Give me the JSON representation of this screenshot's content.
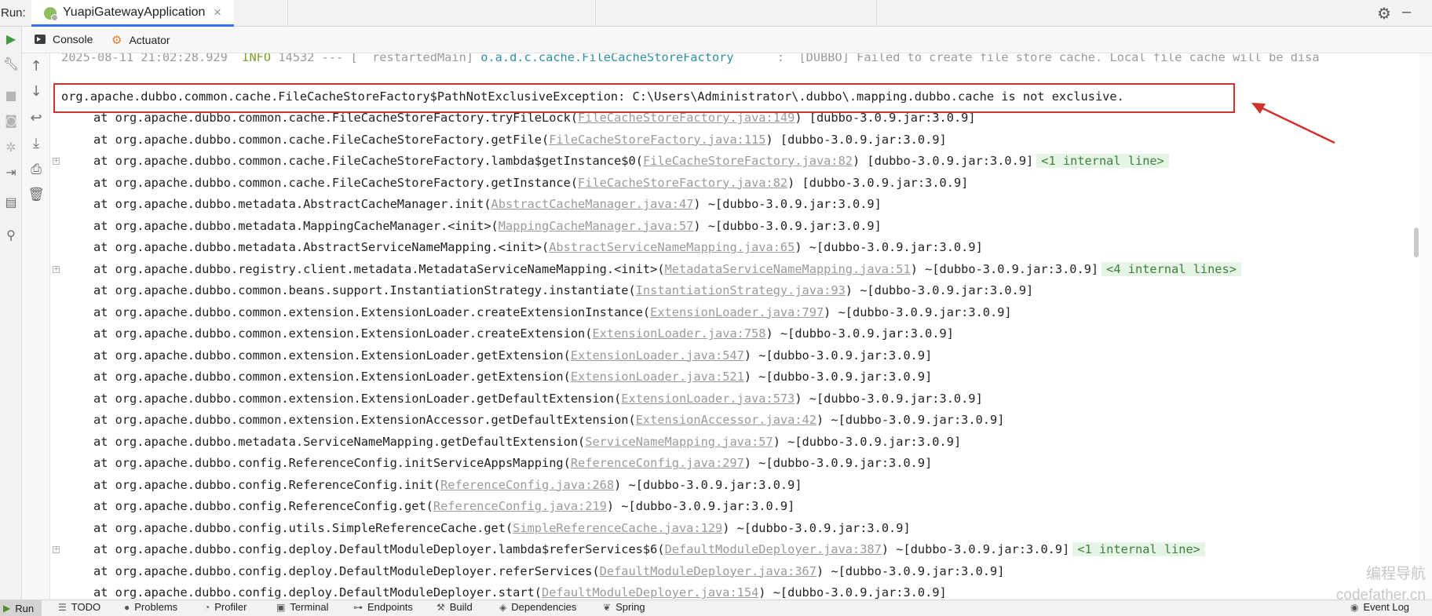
{
  "run_bar": {
    "label": "Run:",
    "tab_title": "YuapiGatewayApplication",
    "close_glyph": "×",
    "settings_icon": "gear-icon",
    "minimize_icon": "minimize-icon"
  },
  "sub_toolbar": {
    "tabs": [
      {
        "label": "Console",
        "icon": "console-icon"
      },
      {
        "label": "Actuator",
        "icon": "actuator-icon"
      }
    ]
  },
  "left_strip_icons": [
    "rerun-icon",
    "wrench-icon",
    "stop-icon",
    "camera-icon",
    "gear-icon",
    "login-icon",
    "layout-icon",
    "pin-icon"
  ],
  "console_toolbar_icons": [
    "up-arrow-icon",
    "down-arrow-icon",
    "soft-wrap-icon",
    "scroll-to-end-icon",
    "print-icon",
    "trash-icon"
  ],
  "console": {
    "top_log": {
      "date": "2025-08-11 21:02:28.929",
      "level": "INFO",
      "pid": "14532",
      "sep": "---",
      "thread": "[  restartedMain]",
      "logger": "o.a.d.c.cache.FileCacheStoreFactory",
      "message": ":  [DUBBO] Failed to create file store cache. Local file cache will be disa"
    },
    "exception": "org.apache.dubbo.common.cache.FileCacheStoreFactory$PathNotExclusiveException: C:\\Users\\Administrator\\.dubbo\\.mapping.dubbo.cache is not exclusive.",
    "frames": [
      {
        "method": "at org.apache.dubbo.common.cache.FileCacheStoreFactory.tryFileLock(",
        "link": "FileCacheStoreFactory.java:149",
        "tail": ") [dubbo-3.0.9.jar:3.0.9]",
        "badge": ""
      },
      {
        "method": "at org.apache.dubbo.common.cache.FileCacheStoreFactory.getFile(",
        "link": "FileCacheStoreFactory.java:115",
        "tail": ") [dubbo-3.0.9.jar:3.0.9]",
        "badge": ""
      },
      {
        "method": "at org.apache.dubbo.common.cache.FileCacheStoreFactory.lambda$getInstance$0(",
        "link": "FileCacheStoreFactory.java:82",
        "tail": ") [dubbo-3.0.9.jar:3.0.9]",
        "badge": "<1 internal line>"
      },
      {
        "method": "at org.apache.dubbo.common.cache.FileCacheStoreFactory.getInstance(",
        "link": "FileCacheStoreFactory.java:82",
        "tail": ") [dubbo-3.0.9.jar:3.0.9]",
        "badge": ""
      },
      {
        "method": "at org.apache.dubbo.metadata.AbstractCacheManager.init(",
        "link": "AbstractCacheManager.java:47",
        "tail": ") ~[dubbo-3.0.9.jar:3.0.9]",
        "badge": ""
      },
      {
        "method": "at org.apache.dubbo.metadata.MappingCacheManager.<init>(",
        "link": "MappingCacheManager.java:57",
        "tail": ") ~[dubbo-3.0.9.jar:3.0.9]",
        "badge": ""
      },
      {
        "method": "at org.apache.dubbo.metadata.AbstractServiceNameMapping.<init>(",
        "link": "AbstractServiceNameMapping.java:65",
        "tail": ") ~[dubbo-3.0.9.jar:3.0.9]",
        "badge": ""
      },
      {
        "method": "at org.apache.dubbo.registry.client.metadata.MetadataServiceNameMapping.<init>(",
        "link": "MetadataServiceNameMapping.java:51",
        "tail": ") ~[dubbo-3.0.9.jar:3.0.9]",
        "badge": "<4 internal lines>"
      },
      {
        "method": "at org.apache.dubbo.common.beans.support.InstantiationStrategy.instantiate(",
        "link": "InstantiationStrategy.java:93",
        "tail": ") ~[dubbo-3.0.9.jar:3.0.9]",
        "badge": ""
      },
      {
        "method": "at org.apache.dubbo.common.extension.ExtensionLoader.createExtensionInstance(",
        "link": "ExtensionLoader.java:797",
        "tail": ") ~[dubbo-3.0.9.jar:3.0.9]",
        "badge": ""
      },
      {
        "method": "at org.apache.dubbo.common.extension.ExtensionLoader.createExtension(",
        "link": "ExtensionLoader.java:758",
        "tail": ") ~[dubbo-3.0.9.jar:3.0.9]",
        "badge": ""
      },
      {
        "method": "at org.apache.dubbo.common.extension.ExtensionLoader.getExtension(",
        "link": "ExtensionLoader.java:547",
        "tail": ") ~[dubbo-3.0.9.jar:3.0.9]",
        "badge": ""
      },
      {
        "method": "at org.apache.dubbo.common.extension.ExtensionLoader.getExtension(",
        "link": "ExtensionLoader.java:521",
        "tail": ") ~[dubbo-3.0.9.jar:3.0.9]",
        "badge": ""
      },
      {
        "method": "at org.apache.dubbo.common.extension.ExtensionLoader.getDefaultExtension(",
        "link": "ExtensionLoader.java:573",
        "tail": ") ~[dubbo-3.0.9.jar:3.0.9]",
        "badge": ""
      },
      {
        "method": "at org.apache.dubbo.common.extension.ExtensionAccessor.getDefaultExtension(",
        "link": "ExtensionAccessor.java:42",
        "tail": ") ~[dubbo-3.0.9.jar:3.0.9]",
        "badge": ""
      },
      {
        "method": "at org.apache.dubbo.metadata.ServiceNameMapping.getDefaultExtension(",
        "link": "ServiceNameMapping.java:57",
        "tail": ") ~[dubbo-3.0.9.jar:3.0.9]",
        "badge": ""
      },
      {
        "method": "at org.apache.dubbo.config.ReferenceConfig.initServiceAppsMapping(",
        "link": "ReferenceConfig.java:297",
        "tail": ") ~[dubbo-3.0.9.jar:3.0.9]",
        "badge": ""
      },
      {
        "method": "at org.apache.dubbo.config.ReferenceConfig.init(",
        "link": "ReferenceConfig.java:268",
        "tail": ") ~[dubbo-3.0.9.jar:3.0.9]",
        "badge": ""
      },
      {
        "method": "at org.apache.dubbo.config.ReferenceConfig.get(",
        "link": "ReferenceConfig.java:219",
        "tail": ") ~[dubbo-3.0.9.jar:3.0.9]",
        "badge": ""
      },
      {
        "method": "at org.apache.dubbo.config.utils.SimpleReferenceCache.get(",
        "link": "SimpleReferenceCache.java:129",
        "tail": ") ~[dubbo-3.0.9.jar:3.0.9]",
        "badge": ""
      },
      {
        "method": "at org.apache.dubbo.config.deploy.DefaultModuleDeployer.lambda$referServices$6(",
        "link": "DefaultModuleDeployer.java:387",
        "tail": ") ~[dubbo-3.0.9.jar:3.0.9]",
        "badge": "<1 internal line>"
      },
      {
        "method": "at org.apache.dubbo.config.deploy.DefaultModuleDeployer.referServices(",
        "link": "DefaultModuleDeployer.java:367",
        "tail": ") ~[dubbo-3.0.9.jar:3.0.9]",
        "badge": ""
      },
      {
        "method": "at org.apache.dubbo.config.deploy.DefaultModuleDeployer.start(",
        "link": "DefaultModuleDeployer.java:154",
        "tail": ") ~[dubbo-3.0.9.jar:3.0.9]",
        "badge": ""
      }
    ]
  },
  "bottom_bar": {
    "items": [
      {
        "label": "Run",
        "icon": "play-icon"
      },
      {
        "label": "TODO",
        "icon": "list-icon"
      },
      {
        "label": "Problems",
        "icon": "info-icon"
      },
      {
        "label": "Profiler",
        "icon": "profiler-icon"
      },
      {
        "label": "Terminal",
        "icon": "terminal-icon"
      },
      {
        "label": "Endpoints",
        "icon": "endpoints-icon"
      },
      {
        "label": "Build",
        "icon": "hammer-icon"
      },
      {
        "label": "Dependencies",
        "icon": "layers-icon"
      },
      {
        "label": "Spring",
        "icon": "leaf-icon"
      }
    ],
    "event_log": "Event Log"
  },
  "watermark": {
    "line1": "编程导航",
    "line2": "codefather.cn"
  },
  "colors": {
    "highlight_box": "#d0312d",
    "arrow": "#d0312d",
    "link": "#9a9a9a",
    "badge_bg": "#e6f4e6",
    "tab_accent": "#3574f0"
  }
}
